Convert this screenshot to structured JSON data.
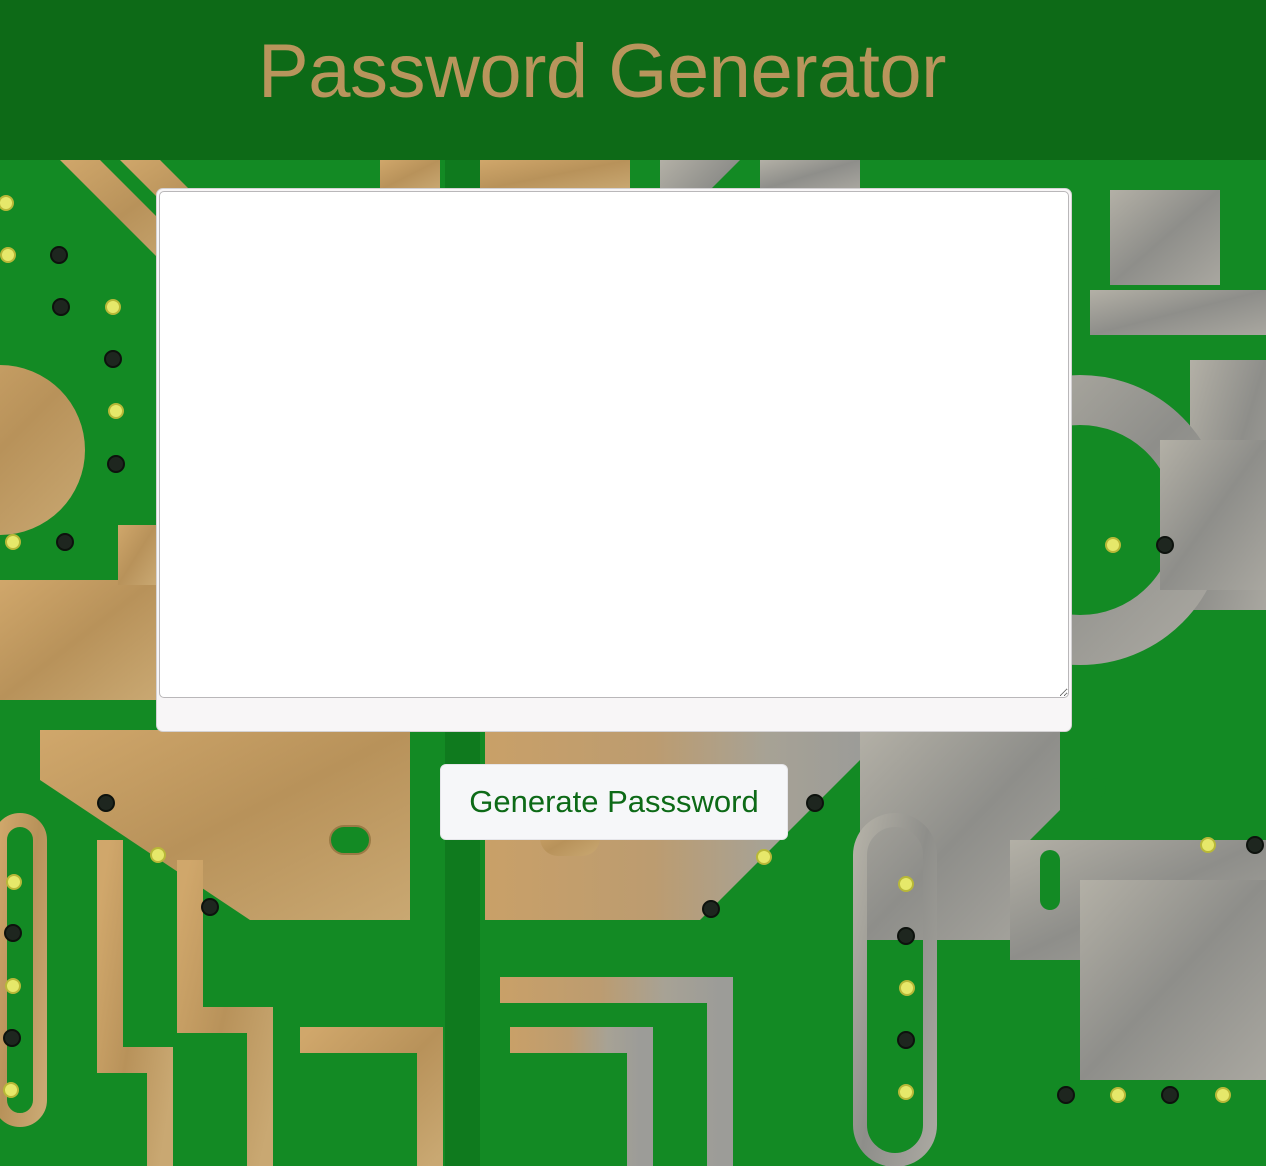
{
  "header": {
    "title": "Password Generator"
  },
  "card": {
    "password_value": "",
    "password_placeholder": ""
  },
  "actions": {
    "generate_label": "Generate Passsword"
  },
  "colors": {
    "header_bg": "#0d6a17",
    "title": "#b8955c",
    "board_green": "#138a24",
    "pad_gold": "#c19a60",
    "pad_silver": "#9a9a9a",
    "button_text": "#0d6a17"
  }
}
